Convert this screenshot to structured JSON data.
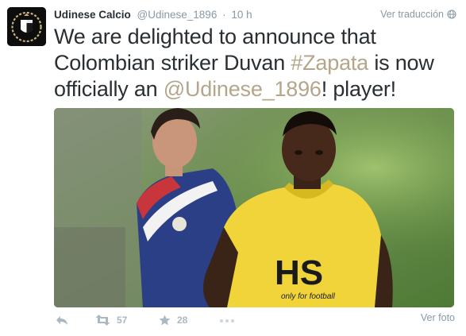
{
  "tweet": {
    "author_name": "Udinese Calcio",
    "handle": "@Udinese_1896",
    "separator": "·",
    "timestamp": "10 h",
    "translate_label": "Ver traducción",
    "text": {
      "part1": "We are delighted to announce that Colombian striker Duvan ",
      "hashtag": "#Zapata",
      "part2": " is now officially an ",
      "mention": "@Udinese_1896",
      "part3": "! player!"
    },
    "media": {
      "shirt_text": "HS",
      "shirt_subtext": "only for football"
    },
    "actions": {
      "reply_icon": "reply-icon",
      "retweet_icon": "retweet-icon",
      "retweet_count": "57",
      "favorite_icon": "star-icon",
      "favorite_count": "28",
      "more_icon": "ellipsis-icon",
      "view_photo_label": "Ver foto"
    }
  },
  "colors": {
    "text": "#292f33",
    "muted": "#8899a6",
    "action": "#aab8c2",
    "entity": "#b5a58a"
  }
}
